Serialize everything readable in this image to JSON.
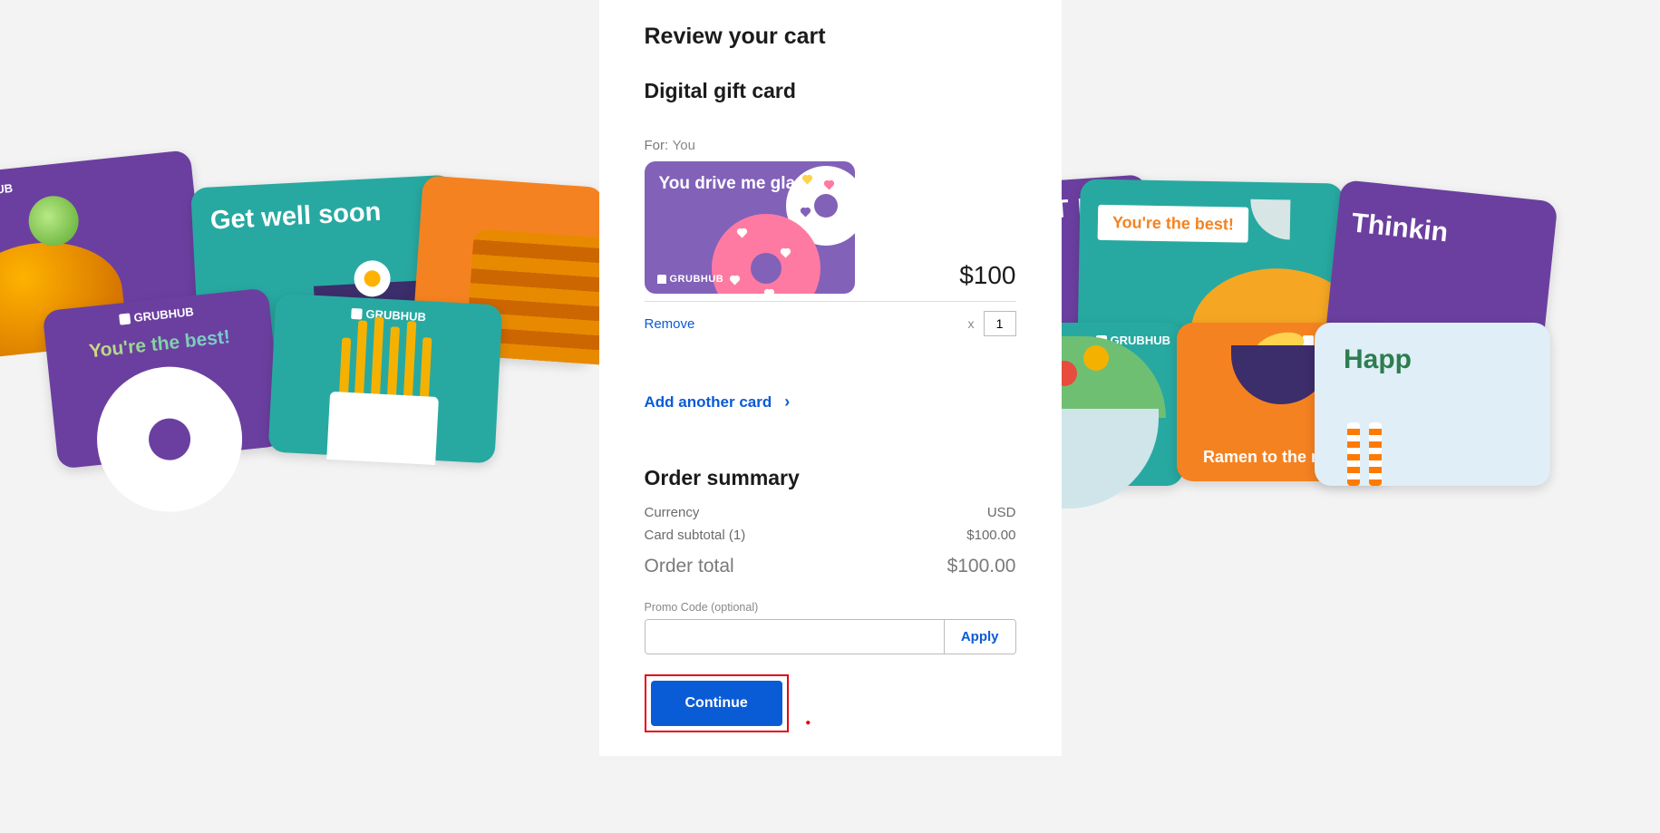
{
  "header": {
    "review_title": "Review your cart",
    "product_title": "Digital gift card"
  },
  "cart_item": {
    "for_label": "For:",
    "for_value": "You",
    "card_slogan": "You drive me glazy",
    "card_brand": "GRUBHUB",
    "price": "$100",
    "remove_label": "Remove",
    "qty_symbol": "x",
    "quantity": "1"
  },
  "actions": {
    "add_another": "Add another card"
  },
  "summary": {
    "title": "Order summary",
    "currency_label": "Currency",
    "currency_value": "USD",
    "subtotal_label": "Card subtotal (1)",
    "subtotal_value": "$100.00",
    "total_label": "Order total",
    "total_value": "$100.00"
  },
  "promo": {
    "label": "Promo Code (optional)",
    "apply": "Apply",
    "value": ""
  },
  "continue_label": "Continue",
  "bg": {
    "brand": "GRUBHUB",
    "getwell": "Get well soon",
    "best": "You're the best!",
    "best_paper": "You're the best!",
    "litday": "A LIT DAY",
    "thinkin": "Thinkin",
    "ramen": "Ramen to the rescue",
    "happ": "Happ"
  }
}
